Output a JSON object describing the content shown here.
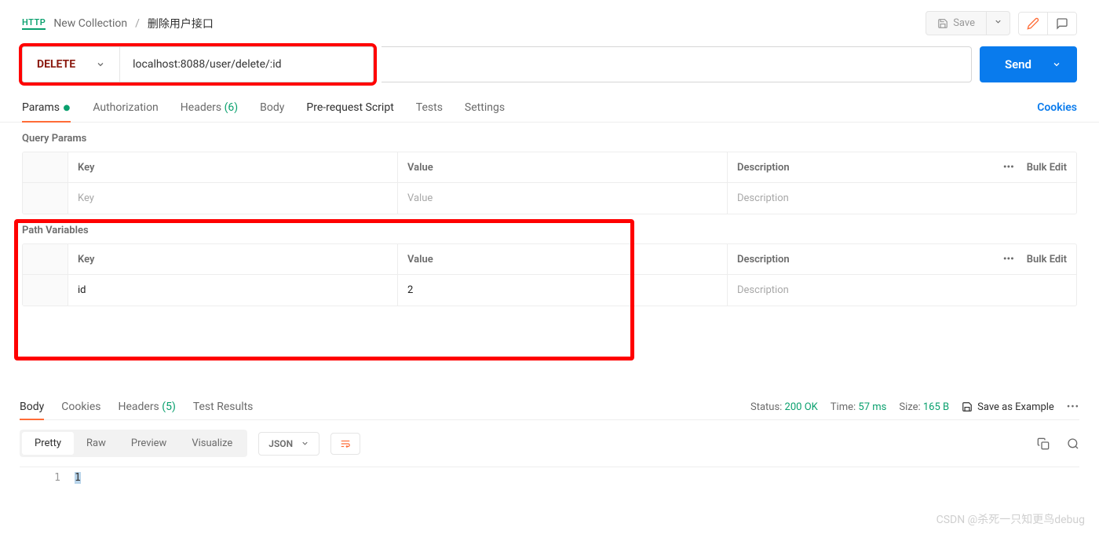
{
  "header": {
    "http_badge": "HTTP",
    "collection": "New Collection",
    "request_name": "删除用户接口",
    "save": "Save"
  },
  "request": {
    "method": "DELETE",
    "url": "localhost:8088/user/delete/:id",
    "send": "Send"
  },
  "tabs": {
    "params": "Params",
    "authorization": "Authorization",
    "headers": "Headers",
    "headers_count": "(6)",
    "body": "Body",
    "prerequest": "Pre-request Script",
    "tests": "Tests",
    "settings": "Settings",
    "cookies": "Cookies"
  },
  "query_params": {
    "title": "Query Params",
    "headers": {
      "key": "Key",
      "value": "Value",
      "desc": "Description",
      "bulk": "Bulk Edit"
    },
    "row": {
      "key_ph": "Key",
      "val_ph": "Value",
      "desc_ph": "Description"
    }
  },
  "path_vars": {
    "title": "Path Variables",
    "headers": {
      "key": "Key",
      "value": "Value",
      "desc": "Description",
      "bulk": "Bulk Edit"
    },
    "row": {
      "key": "id",
      "value": "2",
      "desc_ph": "Description"
    }
  },
  "response": {
    "tabs": {
      "body": "Body",
      "cookies": "Cookies",
      "headers": "Headers",
      "headers_count": "(5)",
      "tests": "Test Results"
    },
    "status_label": "Status:",
    "status_value": "200 OK",
    "time_label": "Time:",
    "time_value": "57 ms",
    "size_label": "Size:",
    "size_value": "165 B",
    "save_example": "Save as Example",
    "format": {
      "pretty": "Pretty",
      "raw": "Raw",
      "preview": "Preview",
      "visualize": "Visualize",
      "json": "JSON"
    },
    "code": {
      "line": "1",
      "content": "1"
    }
  },
  "watermark": "CSDN @杀死一只知更鸟debug"
}
